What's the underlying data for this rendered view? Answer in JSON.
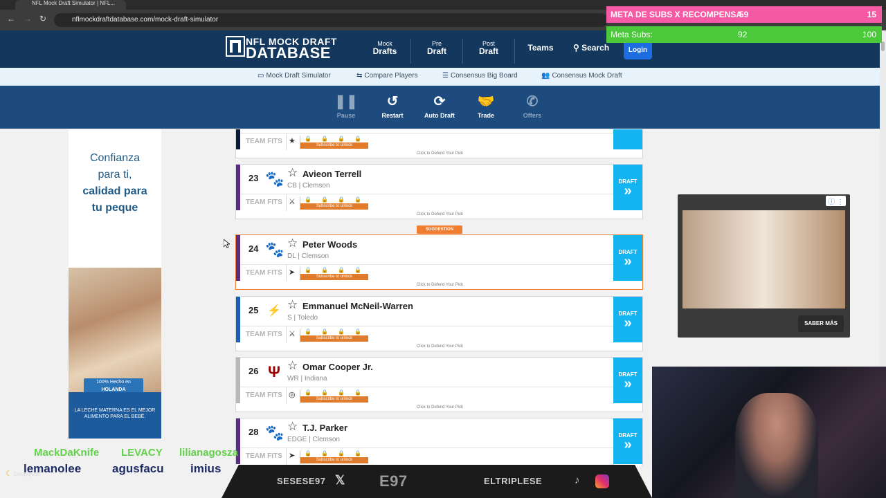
{
  "browser": {
    "tab_title": "NFL Mock Draft Simulator | NFL...",
    "url": "nflmockdraftdatabase.com/mock-draft-simulator"
  },
  "header": {
    "logo_line1": "NFL MOCK DRAFT",
    "logo_line2": "DATABASE",
    "nav": [
      {
        "top": "Mock",
        "main": "Drafts"
      },
      {
        "top": "Pre",
        "main": "Draft"
      },
      {
        "top": "Post",
        "main": "Draft"
      },
      {
        "top": "",
        "main": "Teams"
      },
      {
        "top": "",
        "main": "Search"
      }
    ],
    "login": "Login"
  },
  "subnav": [
    "Mock Draft Simulator",
    "Compare Players",
    "Consensus Big Board",
    "Consensus Mock Draft"
  ],
  "toolbar": {
    "pause": "Pause",
    "restart": "Restart",
    "auto_draft": "Auto Draft",
    "trade": "Trade",
    "offers": "Offers"
  },
  "left_ad": {
    "line1": "Confianza",
    "line2": "para ti,",
    "line3": "calidad para",
    "line4": "tu peque",
    "badge_top": "100% Hecho en",
    "badge_main": "HOLANDA",
    "footer": "LA LECHE MATERNA ES EL MEJOR ALIMENTO PARA EL BEBÉ."
  },
  "common": {
    "team_fits": "TEAM FITS",
    "subscribe": "Subscribe to unlock",
    "defend": "Click to Defend Your Pick",
    "draft": "DRAFT",
    "suggestion": "SUGGESTION"
  },
  "players": [
    {
      "pick": "23",
      "name": "Avieon Terrell",
      "pos": "CB | Clemson",
      "color": "#5a2d82",
      "logo": "clemson"
    },
    {
      "pick": "24",
      "name": "Peter Woods",
      "pos": "DL | Clemson",
      "color": "#5a2d82",
      "logo": "clemson",
      "suggested": true
    },
    {
      "pick": "25",
      "name": "Emmanuel McNeil-Warren",
      "pos": "S | Toledo",
      "color": "#1a5fb4",
      "logo": "toledo"
    },
    {
      "pick": "26",
      "name": "Omar Cooper Jr.",
      "pos": "WR | Indiana",
      "color": "#b8b8b8",
      "logo": "indiana"
    },
    {
      "pick": "28",
      "name": "T.J. Parker",
      "pos": "EDGE | Clemson",
      "color": "#5a2d82",
      "logo": "clemson"
    }
  ],
  "right_ad": {
    "cta": "SABER MÁS"
  },
  "overlay": {
    "bar1_label": "META DE SUBS X RECOMPENSA",
    "bar1_value": "59",
    "bar1_goal": "15",
    "bar2_label": "Meta Subs:",
    "bar2_value": "92",
    "bar2_goal": "100",
    "chat_row1": [
      "MackDaKnife",
      "LEVACY",
      "lilianagosza"
    ],
    "chat_row2": [
      "lemanolee",
      "agusfacu",
      "imius"
    ],
    "handle_left": "SESESE97",
    "logo_center": "E97",
    "handle_right": "ELTRIPLESE",
    "weather": "Despejado"
  }
}
